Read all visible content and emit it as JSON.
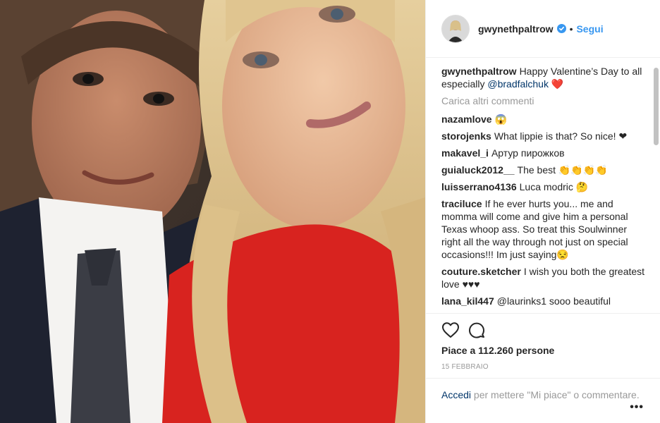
{
  "post": {
    "username": "gwynethpaltrow",
    "separator": "•",
    "follow_label": "Segui",
    "caption": "Happy Valentine’s Day to all especially",
    "caption_mention": "@bradfalchuk",
    "caption_emoji": "❤️",
    "load_more_label": "Carica altri commenti",
    "comments": [
      {
        "user": "nazamlove",
        "text": "😱"
      },
      {
        "user": "storojenks",
        "text": "What lippie is that? So nice! ❤"
      },
      {
        "user": "makavel_i",
        "text": "Артур пирожков"
      },
      {
        "user": "guialuck2012__",
        "text": "The best 👏👏👏👏"
      },
      {
        "user": "luisserrano4136",
        "text": "Luca modric 🤔"
      },
      {
        "user": "traciluce",
        "text": "If he ever hurts you... me and momma will come and give him a personal Texas whoop ass. So treat this Soulwinner right all the way through not just on special occasions!!! Im just saying😒"
      },
      {
        "user": "couture.sketcher",
        "text": "I wish you both the greatest love ♥♥♥"
      },
      {
        "user": "lana_kil447",
        "text": "@laurinks1 sooo beautiful"
      }
    ],
    "likes_label": "Piace a 112.260 persone",
    "date_label": "15 FEBBRAIO",
    "footer": {
      "login_label": "Accedi",
      "rest_text": "per mettere \"Mi piace\" o commentare."
    },
    "more_options": "•••"
  },
  "icons": {
    "like": "heart-outline-icon",
    "comment": "speech-bubble-icon",
    "verified": "verified-badge-icon"
  },
  "colors": {
    "link_blue": "#3897f0",
    "mention_navy": "#003569",
    "muted_gray": "#999999",
    "text": "#262626"
  }
}
